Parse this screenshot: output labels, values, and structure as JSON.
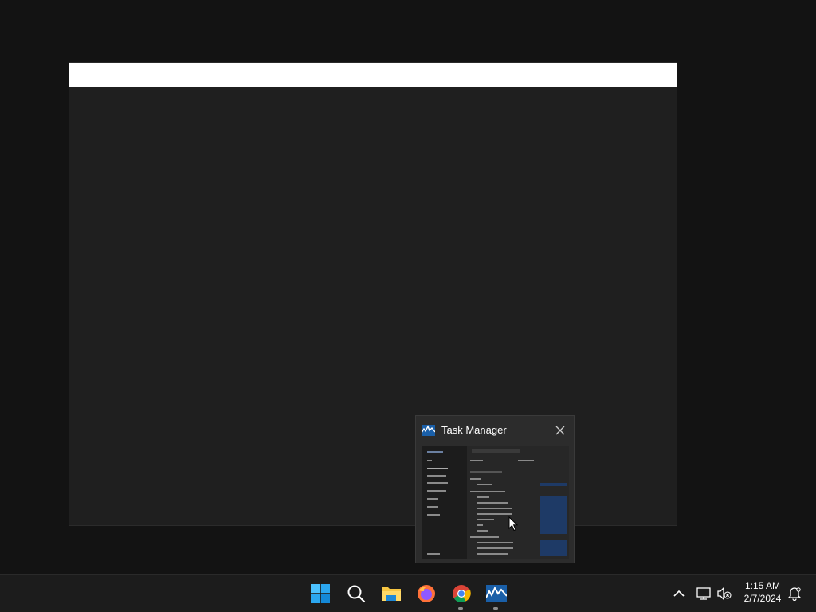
{
  "preview": {
    "title": "Task Manager",
    "app_icon": "task-manager-icon",
    "close_icon": "close-icon"
  },
  "taskbar": {
    "apps": [
      {
        "name": "start",
        "icon": "windows-logo-icon"
      },
      {
        "name": "search",
        "icon": "search-icon"
      },
      {
        "name": "file-explorer",
        "icon": "folder-icon"
      },
      {
        "name": "firefox",
        "icon": "firefox-icon"
      },
      {
        "name": "chrome",
        "icon": "chrome-icon"
      },
      {
        "name": "task-manager",
        "icon": "task-manager-icon"
      }
    ],
    "tray": {
      "show_hidden_icon": "chevron-up-icon",
      "network_icon": "network-icon",
      "volume_icon": "volume-muted-icon",
      "notification_icon": "notification-bell-icon"
    },
    "clock": {
      "time": "1:15 AM",
      "date": "2/7/2024"
    }
  },
  "colors": {
    "desktop": "#131313",
    "taskbar": "#1c1c1c",
    "accent": "#0078d4"
  }
}
